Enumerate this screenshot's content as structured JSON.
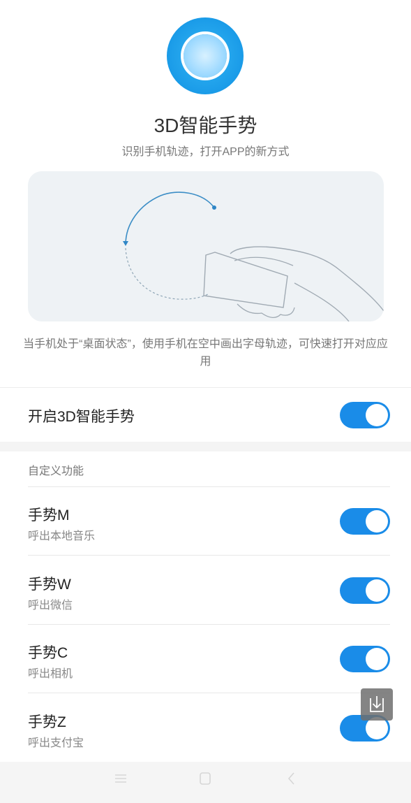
{
  "header": {
    "title": "3D智能手势",
    "subtitle": "识别手机轨迹，打开APP的新方式"
  },
  "description": "当手机处于“桌面状态”，使用手机在空中画出字母轨迹，可快速打开对应应用",
  "main_toggle": {
    "label": "开启3D智能手势",
    "enabled": true
  },
  "custom_section": {
    "header": "自定义功能"
  },
  "gestures": [
    {
      "name": "手势M",
      "action": "呼出本地音乐",
      "enabled": true
    },
    {
      "name": "手势W",
      "action": "呼出微信",
      "enabled": true
    },
    {
      "name": "手势C",
      "action": "呼出相机",
      "enabled": true
    },
    {
      "name": "手势Z",
      "action": "呼出支付宝",
      "enabled": true
    }
  ],
  "colors": {
    "accent": "#1a8ce8",
    "background": "#ffffff",
    "illustration_bg": "#eef2f5"
  },
  "icons": {
    "hero": "gesture-circle-icon",
    "floating": "download-screenshot-icon",
    "nav": [
      "menu-icon",
      "home-icon",
      "back-icon"
    ]
  }
}
